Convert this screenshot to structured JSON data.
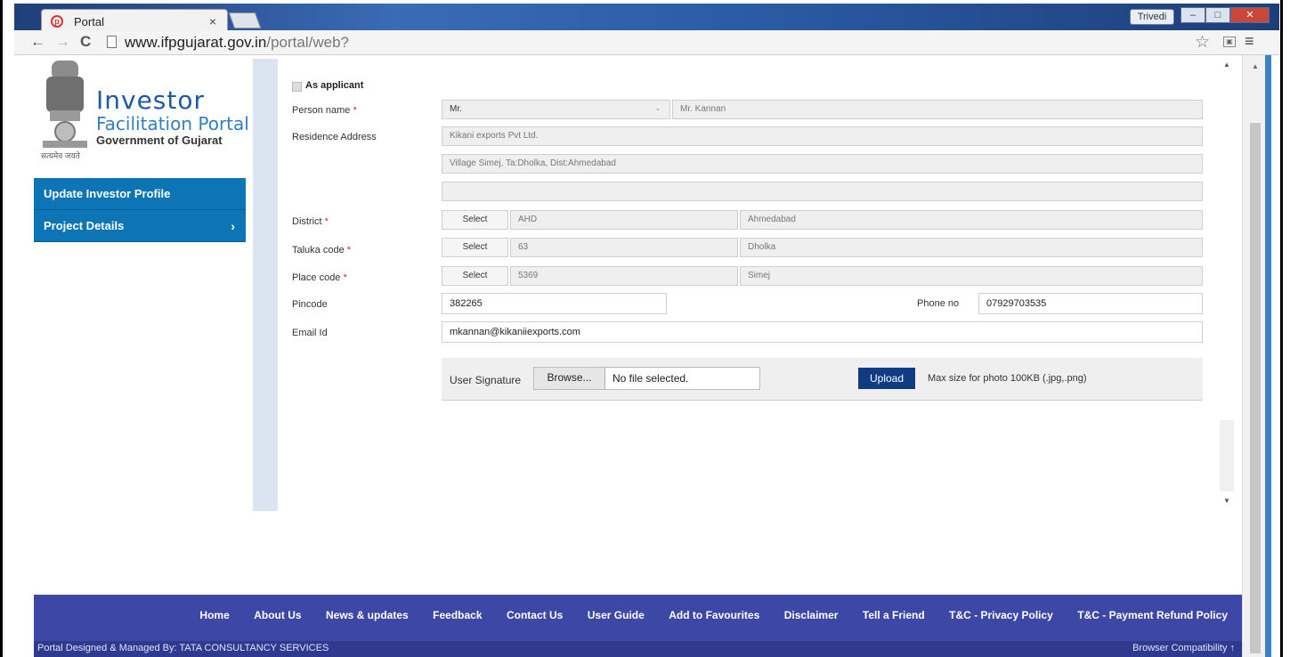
{
  "browser": {
    "tab_title": "Portal",
    "tab_close": "×",
    "user_chip": "Trivedi",
    "url_host": "www.ifpgujarat.gov.in",
    "url_path": "/portal/web?",
    "icons": [
      "portal-favicon",
      "back-icon",
      "forward-icon",
      "reload-icon",
      "star-icon",
      "menu-icon"
    ]
  },
  "logo": {
    "line1": "Investor",
    "line2": "Facilitation Portal",
    "line3": "Government of Gujarat",
    "motto": "सत्यमेव जयते"
  },
  "sidebar": {
    "items": [
      {
        "label": "Update Investor Profile"
      },
      {
        "label": "Project Details",
        "chevron": "›"
      }
    ]
  },
  "form": {
    "as_applicant_label": "As applicant",
    "person_name_label": "Person name",
    "person_title": "Mr.",
    "person_name_value": "Mr. Kannan",
    "residence_label": "Residence Address",
    "address_line1": "Kikani exports Pvt Ltd.",
    "address_line2": "Village Simej, Ta:Dholka, Dist:Ahmedabad",
    "address_line3": "",
    "district_label": "District",
    "district_code": "AHD",
    "district_name": "Ahmedabad",
    "taluka_label": "Taluka code",
    "taluka_code": "63",
    "taluka_name": "Dholka",
    "place_label": "Place code",
    "place_code": "5369",
    "place_name": "Simej",
    "select_label": "Select",
    "pincode_label": "Pincode",
    "pincode_value": "382265",
    "phone_label": "Phone no",
    "phone_value": "07929703535",
    "email_label": "Email Id",
    "email_value": "mkannan@kikaniiexports.com",
    "required_mark": "*",
    "signature_label": "User Signature",
    "browse_label": "Browse...",
    "file_status": "No file selected.",
    "upload_label": "Upload",
    "upload_hint": "Max size for photo 100KB (.jpg,.png)"
  },
  "footer": {
    "links": [
      "Home",
      "About Us",
      "News & updates",
      "Feedback",
      "Contact Us",
      "User Guide",
      "Add to Favourites",
      "Disclaimer",
      "Tell a Friend",
      "T&C - Privacy Policy",
      "T&C - Payment Refund Policy"
    ],
    "credit": "Portal Designed & Managed By: TATA CONSULTANCY SERVICES",
    "compat": "Browser Compatibility  ↑"
  },
  "colors": {
    "sidebar_blue": "#0d75b6",
    "footer_blue": "#3d48a6",
    "upload_button": "#0f3a84",
    "required_red": "#d22222"
  }
}
